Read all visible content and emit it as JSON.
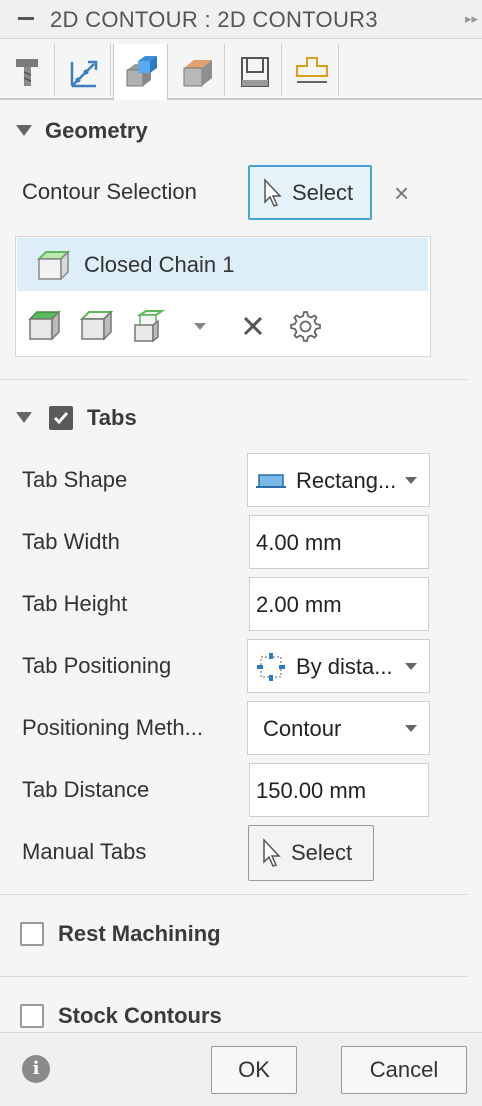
{
  "window": {
    "title": "2D CONTOUR : 2D CONTOUR3"
  },
  "tabs": [
    {
      "name": "tool-tab",
      "icon": "tool-icon"
    },
    {
      "name": "heights-tab",
      "icon": "heights-axis-icon"
    },
    {
      "name": "geometry-tab",
      "icon": "geometry-box-icon"
    },
    {
      "name": "passes-tab",
      "icon": "passes-box-icon"
    },
    {
      "name": "linking-tab",
      "icon": "linking-icon"
    },
    {
      "name": "post-tab",
      "icon": "post-icon"
    }
  ],
  "geometry": {
    "title": "Geometry",
    "contour_selection_label": "Contour Selection",
    "select_label": "Select",
    "clear_glyph": "×",
    "chain_item": "Closed Chain 1"
  },
  "tabs_section": {
    "title": "Tabs",
    "checked": true,
    "tab_shape_label": "Tab Shape",
    "tab_shape_value": "Rectang...",
    "tab_width_label": "Tab Width",
    "tab_width_value": "4.00 mm",
    "tab_height_label": "Tab Height",
    "tab_height_value": "2.00 mm",
    "tab_positioning_label": "Tab Positioning",
    "tab_positioning_value": "By dista...",
    "positioning_method_label": "Positioning Meth...",
    "positioning_method_value": "Contour",
    "tab_distance_label": "Tab Distance",
    "tab_distance_value": "150.00 mm",
    "manual_tabs_label": "Manual Tabs",
    "manual_tabs_select": "Select"
  },
  "rest_machining": {
    "label": "Rest Machining",
    "checked": false
  },
  "stock_contours": {
    "label": "Stock Contours",
    "checked": false
  },
  "footer": {
    "info_glyph": "i",
    "ok_label": "OK",
    "cancel_label": "Cancel"
  },
  "colors": {
    "accent": "#4aa3d8",
    "selection_bg": "#ddeef8",
    "chain_green": "#5cb85c"
  }
}
